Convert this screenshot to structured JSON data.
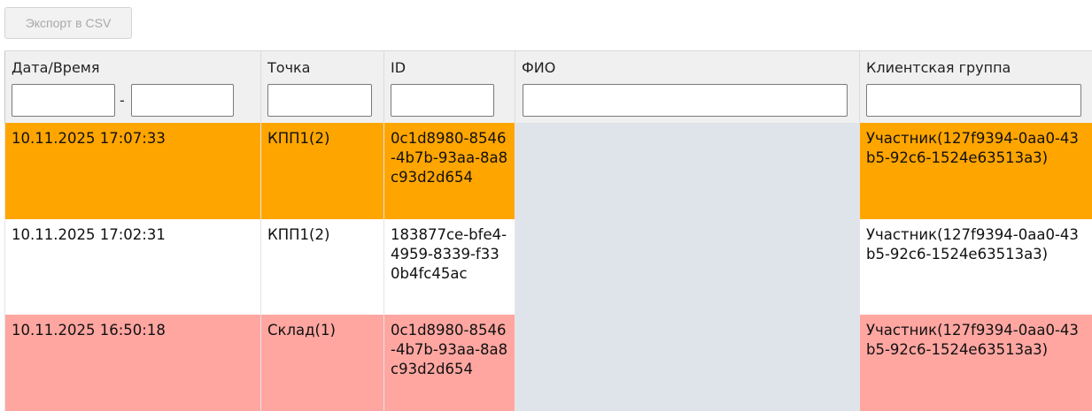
{
  "toolbar": {
    "export_label": "Экспорт в CSV"
  },
  "columns": {
    "datetime": "Дата/Время",
    "point": "Точка",
    "id": "ID",
    "fio": "ФИО",
    "client_group": "Клиентская группа"
  },
  "filters": {
    "date_from": "",
    "date_separator": "-",
    "date_to": "",
    "point": "",
    "id": "",
    "fio": "",
    "client_group": ""
  },
  "row_colors": {
    "orange": "#ffa500",
    "white": "#ffffff",
    "pink": "#ffa6a1",
    "fio_column": "#dfe3ea"
  },
  "rows": [
    {
      "datetime": "10.11.2025 17:07:33",
      "point": "КПП1(2)",
      "id": "0c1d8980-8546-4b7b-93aa-8a8c93d2d654",
      "fio": "",
      "client_group": "Участник(127f9394-0aa0-43b5-92c6-1524e63513a3)"
    },
    {
      "datetime": "10.11.2025 17:02:31",
      "point": "КПП1(2)",
      "id": "183877ce-bfe4-4959-8339-f330b4fc45ac",
      "fio": "",
      "client_group": "Участник(127f9394-0aa0-43b5-92c6-1524e63513a3)"
    },
    {
      "datetime": "10.11.2025 16:50:18",
      "point": "Склад(1)",
      "id": "0c1d8980-8546-4b7b-93aa-8a8c93d2d654",
      "fio": "",
      "client_group": "Участник(127f9394-0aa0-43b5-92c6-1524e63513a3)"
    }
  ]
}
